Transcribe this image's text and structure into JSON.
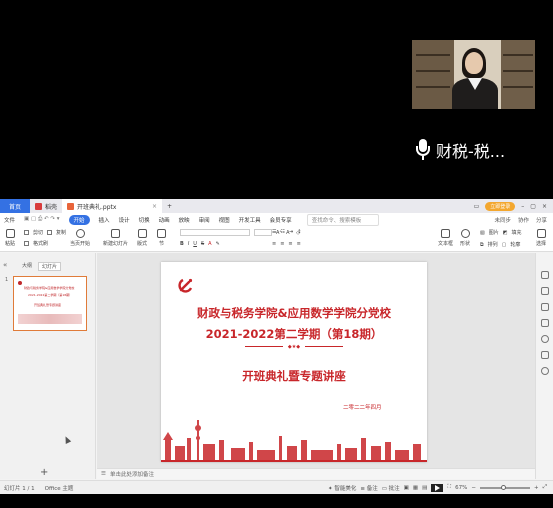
{
  "meeting": {
    "speaker_name": "财税-税...",
    "accent": "#ffffff"
  },
  "tabs": {
    "home": "首页",
    "wps_tab": "稻壳",
    "doc_tab": "开班典礼.pptx",
    "login_button": "立即登录",
    "accent_color": "#3471e3"
  },
  "menu": {
    "file": "文件",
    "start": "开始",
    "items": [
      "插入",
      "设计",
      "切换",
      "动画",
      "放映",
      "审阅",
      "视图",
      "开发工具",
      "会员专享"
    ],
    "search_placeholder": "查找命令、搜索模板",
    "right": [
      "未同步",
      "协作",
      "分享"
    ]
  },
  "ribbon": {
    "paste": "粘贴",
    "cut": "剪切",
    "copy": "复制",
    "format_painter": "格式刷",
    "from_current": "当页开始",
    "new_slide": "新建幻灯片",
    "layout": "版式",
    "section": "节",
    "textbox": "文本框",
    "shape": "形状",
    "picture": "图片",
    "fill": "填充",
    "arrange": "排列",
    "outline": "轮廓",
    "replace": "替换",
    "select": "选择"
  },
  "left_pane": {
    "outline_tab": "大纲",
    "slides_tab": "幻灯片",
    "slide_number": "1",
    "thumb_line1": "财政与税务学院&应用数学学院分党校",
    "thumb_line2": "2021-2022第二学期（第18期）",
    "thumb_line3": "开班典礼暨专题讲座"
  },
  "slide": {
    "line1": "财政与税务学院&应用数学学院分党校",
    "line2": "2021-2022第二学期（第18期）",
    "line3": "开班典礼暨专题讲座",
    "date": "二零二二年四月",
    "theme_color": "#c8262a"
  },
  "notes": {
    "placeholder": "单击此处添加备注"
  },
  "status": {
    "slide_count": "幻灯片 1 / 1",
    "theme": "Office 主题",
    "smart_beautify": "智能美化",
    "notes": "备注",
    "comments": "批注",
    "zoom": "67%"
  }
}
